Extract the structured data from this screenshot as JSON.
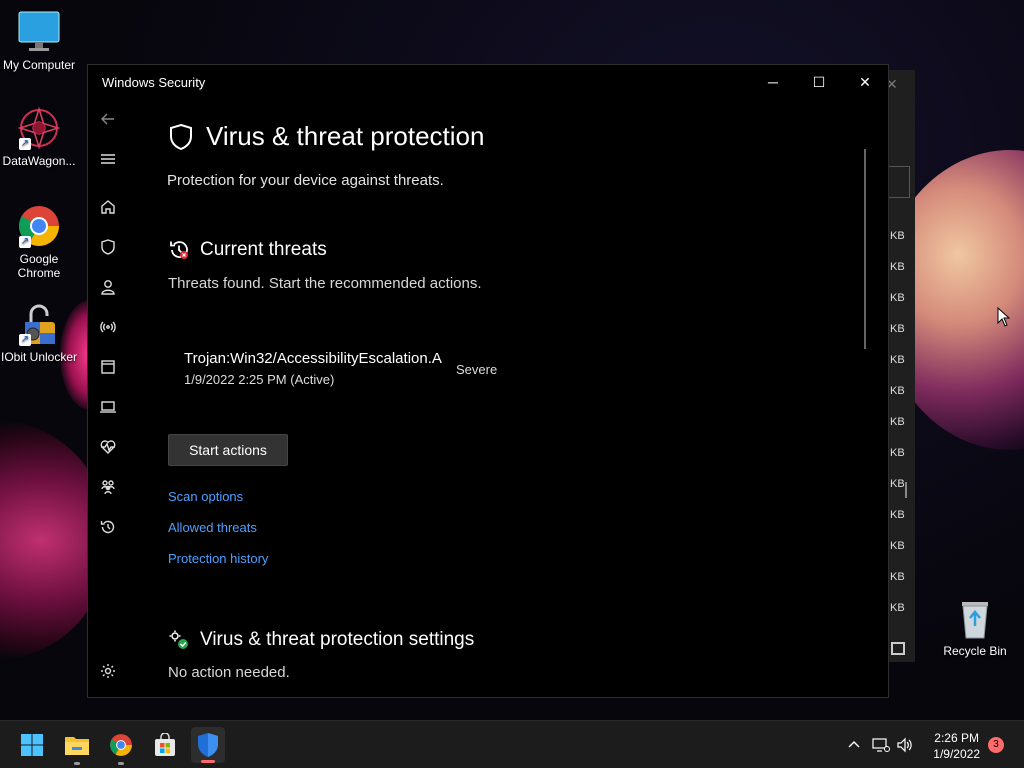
{
  "desktop": {
    "icons": [
      {
        "label": "My Computer"
      },
      {
        "label": "DataWagon..."
      },
      {
        "label": "Google Chrome"
      },
      {
        "label": "IObit Unlocker"
      },
      {
        "label": "Recycle Bin"
      }
    ]
  },
  "background_window": {
    "close_glyph": "✕",
    "size_unit": "KB"
  },
  "window": {
    "title": "Windows Security",
    "controls": {
      "minimize": "─",
      "maximize": "☐",
      "close": "✕"
    },
    "sidebar": [
      {
        "name": "back-icon"
      },
      {
        "name": "menu-icon"
      },
      {
        "name": "home-icon"
      },
      {
        "name": "shield-icon"
      },
      {
        "name": "account-icon"
      },
      {
        "name": "network-icon"
      },
      {
        "name": "app-browser-icon"
      },
      {
        "name": "device-security-icon"
      },
      {
        "name": "health-icon"
      },
      {
        "name": "family-icon"
      },
      {
        "name": "history-icon"
      },
      {
        "name": "settings-icon"
      }
    ],
    "page": {
      "title": "Virus & threat protection",
      "subtitle": "Protection for your device against threats.",
      "current_threats": {
        "title": "Current threats",
        "desc": "Threats found. Start the recommended actions.",
        "threat": {
          "name": "Trojan:Win32/AccessibilityEscalation.A",
          "date": "1/9/2022 2:25 PM (Active)",
          "severity": "Severe"
        },
        "start_button": "Start actions",
        "links": [
          "Scan options",
          "Allowed threats",
          "Protection history"
        ]
      },
      "settings": {
        "title": "Virus & threat protection settings",
        "desc": "No action needed."
      }
    }
  },
  "taskbar": {
    "apps": [
      "start-icon",
      "file-explorer-icon",
      "chrome-icon",
      "store-icon",
      "windows-security-icon"
    ],
    "clock_time": "2:26 PM",
    "clock_date": "1/9/2022",
    "notification_count": "3"
  },
  "colors": {
    "accent_link": "#4da0ff",
    "window_bg": "#000000",
    "taskbar_bg": "#1c1c1c",
    "badge": "#ff6b6b"
  }
}
